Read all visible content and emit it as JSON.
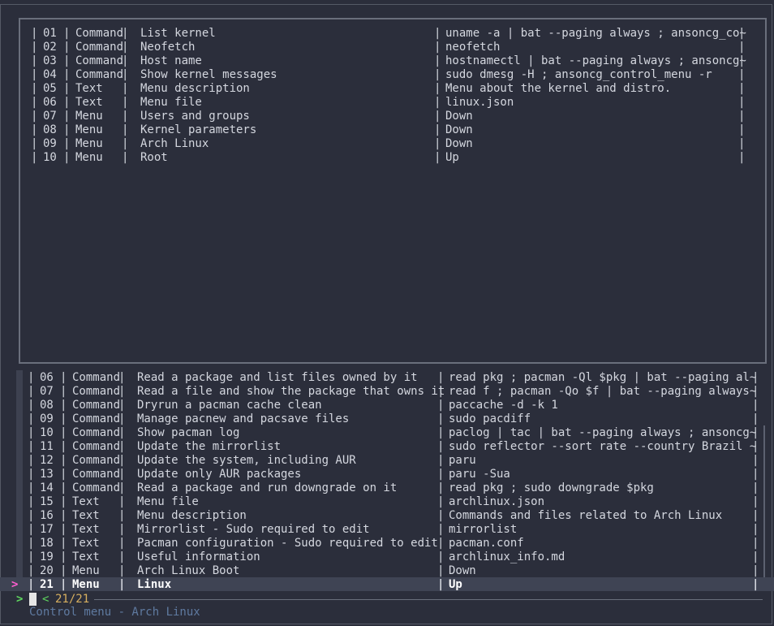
{
  "preview_rows": [
    {
      "num": "01",
      "type": "Command",
      "desc": "List kernel",
      "cmd": "uname -a | bat --paging always ; ansoncg_co~"
    },
    {
      "num": "02",
      "type": "Command",
      "desc": "Neofetch",
      "cmd": "neofetch"
    },
    {
      "num": "03",
      "type": "Command",
      "desc": "Host name",
      "cmd": "hostnamectl | bat --paging always ; ansoncg~"
    },
    {
      "num": "04",
      "type": "Command",
      "desc": "Show kernel messages",
      "cmd": "sudo dmesg -H ; ansoncg_control_menu -r"
    },
    {
      "num": "05",
      "type": "Text",
      "desc": "Menu description",
      "cmd": "Menu about the kernel and distro."
    },
    {
      "num": "06",
      "type": "Text",
      "desc": "Menu file",
      "cmd": "linux.json"
    },
    {
      "num": "07",
      "type": "Menu",
      "desc": "Users and groups",
      "cmd": "Down"
    },
    {
      "num": "08",
      "type": "Menu",
      "desc": "Kernel parameters",
      "cmd": "Down"
    },
    {
      "num": "09",
      "type": "Menu",
      "desc": "Arch Linux",
      "cmd": "Down"
    },
    {
      "num": "10",
      "type": "Menu",
      "desc": "Root",
      "cmd": "Up"
    }
  ],
  "list_rows": [
    {
      "num": "06",
      "type": "Command",
      "desc": "Read a package and list files owned by it",
      "cmd": "read pkg ; pacman -Ql $pkg | bat --paging al~"
    },
    {
      "num": "07",
      "type": "Command",
      "desc": "Read a file and show the package that owns it",
      "cmd": "read f ; pacman -Qo $f | bat --paging always~"
    },
    {
      "num": "08",
      "type": "Command",
      "desc": "Dryrun a pacman cache clean",
      "cmd": "paccache -d -k 1"
    },
    {
      "num": "09",
      "type": "Command",
      "desc": "Manage pacnew and pacsave files",
      "cmd": "sudo pacdiff"
    },
    {
      "num": "10",
      "type": "Command",
      "desc": "Show pacman log",
      "cmd": "paclog | tac | bat --paging always ; ansoncg~"
    },
    {
      "num": "11",
      "type": "Command",
      "desc": "Update the mirrorlist",
      "cmd": "sudo reflector --sort rate --country Brazil ~"
    },
    {
      "num": "12",
      "type": "Command",
      "desc": "Update the system, including AUR",
      "cmd": "paru"
    },
    {
      "num": "13",
      "type": "Command",
      "desc": "Update only AUR packages",
      "cmd": "paru -Sua"
    },
    {
      "num": "14",
      "type": "Command",
      "desc": "Read a package and run downgrade on it",
      "cmd": "read pkg ; sudo downgrade $pkg"
    },
    {
      "num": "15",
      "type": "Text",
      "desc": "Menu file",
      "cmd": "archlinux.json"
    },
    {
      "num": "16",
      "type": "Text",
      "desc": "Menu description",
      "cmd": "Commands and files related to Arch Linux"
    },
    {
      "num": "17",
      "type": "Text",
      "desc": "Mirrorlist - Sudo required to edit",
      "cmd": "mirrorlist"
    },
    {
      "num": "18",
      "type": "Text",
      "desc": "Pacman configuration - Sudo required to edit",
      "cmd": "pacman.conf"
    },
    {
      "num": "19",
      "type": "Text",
      "desc": "Useful information",
      "cmd": "archlinux_info.md"
    },
    {
      "num": "20",
      "type": "Menu",
      "desc": "Arch Linux Boot",
      "cmd": "Down"
    }
  ],
  "selected_row": {
    "num": "21",
    "type": "Menu",
    "desc": "Linux",
    "cmd": "Up",
    "pointer": ">"
  },
  "prompt": {
    "symbol": ">",
    "counter_arrow": "<",
    "counter": "21/21"
  },
  "header": "Control menu - Arch Linux",
  "separator": "|"
}
